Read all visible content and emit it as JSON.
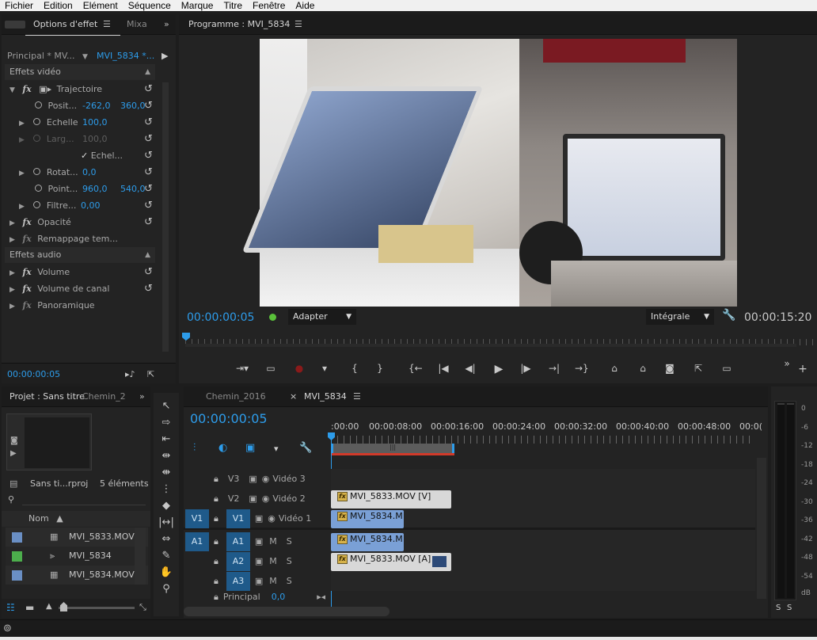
{
  "menu": [
    "Fichier",
    "Edition",
    "Elément",
    "Séquence",
    "Marque",
    "Titre",
    "Fenêtre",
    "Aide"
  ],
  "effect_controls": {
    "tab_label": "Options d'effet",
    "tab_mixer": "Mixa",
    "master": "Principal * MV...",
    "clip": "MVI_5834 *...",
    "video_header": "Effets vidéo",
    "trajectoire": "Trajectoire",
    "position_label": "Posit...",
    "position_x": "-262,0",
    "position_y": "360,0",
    "echelle_label": "Echelle",
    "echelle_value": "100,0",
    "largeur_label": "Larg...",
    "largeur_value": "100,0",
    "uniform_label": "Echel...",
    "rotation_label": "Rotat...",
    "rotation_value": "0,0",
    "anchor_label": "Point...",
    "anchor_x": "960,0",
    "anchor_y": "540,0",
    "filter_label": "Filtre...",
    "filter_value": "0,00",
    "opacite": "Opacité",
    "remap": "Remappage tem...",
    "audio_header": "Effets audio",
    "volume": "Volume",
    "volume_canal": "Volume de canal",
    "panoramique": "Panoramique",
    "timecode": "00:00:00:05"
  },
  "program": {
    "title": "Programme : MVI_5834",
    "timecode_left": "00:00:00:05",
    "timecode_right": "00:00:15:20",
    "fit": "Adapter",
    "quality": "Intégrale"
  },
  "project": {
    "title": "Projet : Sans titre",
    "tab2": "Chemin_2",
    "file": "Sans ti...rproj",
    "count": "5 éléments",
    "col_name": "Nom",
    "items": [
      {
        "name": "MVI_5833.MOV",
        "color": "#6a8fc4"
      },
      {
        "name": "MVI_5834",
        "color": "#4cae4c"
      },
      {
        "name": "MVI_5834.MOV",
        "color": "#6a8fc4"
      }
    ]
  },
  "timeline": {
    "tab1": "Chemin_2016",
    "tab2": "MVI_5834",
    "timecode": "00:00:00:05",
    "ruler": [
      ":00:00",
      "00:00:08:00",
      "00:00:16:00",
      "00:00:24:00",
      "00:00:32:00",
      "00:00:40:00",
      "00:00:48:00",
      "00:0("
    ],
    "tracks": {
      "v3": "V3",
      "v2": "V2",
      "v1": "V1",
      "a1": "A1",
      "a2": "A2",
      "a3": "A3",
      "video3": "Vidéo 3",
      "video2": "Vidéo 2",
      "video1": "Vidéo 1",
      "src_v1": "V1",
      "src_a1": "A1",
      "m": "M",
      "s": "S",
      "principal": "Principal",
      "principal_val": "0,0"
    },
    "clips": {
      "v2": "MVI_5833.MOV [V]",
      "v1": "MVI_5834.M",
      "a1": "MVI_5834.M",
      "a2": "MVI_5833.MOV [A]"
    }
  },
  "meter": {
    "labels": [
      "0",
      "-6",
      "-12",
      "-18",
      "-24",
      "-30",
      "-36",
      "-42",
      "-48",
      "-54",
      "dB"
    ],
    "s1": "S",
    "s2": "S"
  }
}
